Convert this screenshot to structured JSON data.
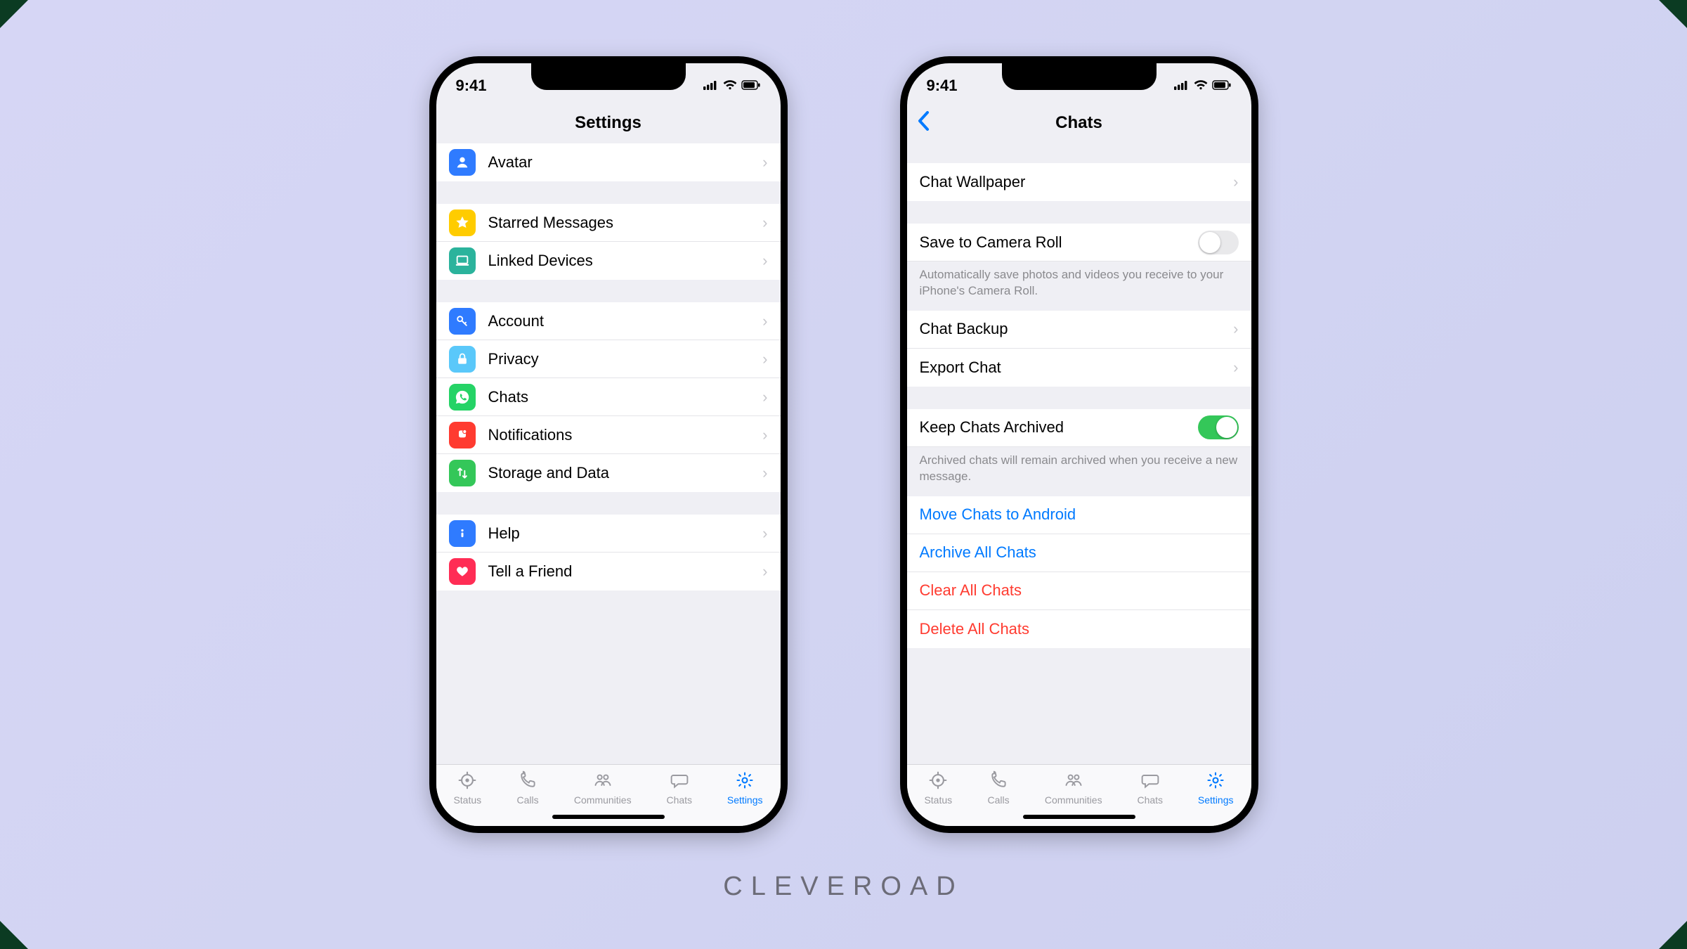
{
  "status": {
    "time": "9:41"
  },
  "brand": "CLEVEROAD",
  "tabs": [
    {
      "label": "Status"
    },
    {
      "label": "Calls"
    },
    {
      "label": "Communities"
    },
    {
      "label": "Chats"
    },
    {
      "label": "Settings"
    }
  ],
  "left": {
    "title": "Settings",
    "groups": [
      [
        {
          "label": "Avatar",
          "iconColor": "#2f7bff",
          "iconName": "avatar-icon"
        }
      ],
      [
        {
          "label": "Starred Messages",
          "iconColor": "#ffcc00",
          "iconName": "star-icon"
        },
        {
          "label": "Linked Devices",
          "iconColor": "#2bb39c",
          "iconName": "laptop-icon"
        }
      ],
      [
        {
          "label": "Account",
          "iconColor": "#2f7bff",
          "iconName": "key-icon"
        },
        {
          "label": "Privacy",
          "iconColor": "#5ac8fa",
          "iconName": "lock-icon"
        },
        {
          "label": "Chats",
          "iconColor": "#25d366",
          "iconName": "whatsapp-icon"
        },
        {
          "label": "Notifications",
          "iconColor": "#ff3b30",
          "iconName": "bell-icon"
        },
        {
          "label": "Storage and Data",
          "iconColor": "#34c759",
          "iconName": "arrows-icon"
        }
      ],
      [
        {
          "label": "Help",
          "iconColor": "#2f7bff",
          "iconName": "info-icon"
        },
        {
          "label": "Tell a Friend",
          "iconColor": "#ff2d55",
          "iconName": "heart-icon"
        }
      ]
    ]
  },
  "right": {
    "title": "Chats",
    "rows": {
      "wallpaper": "Chat Wallpaper",
      "saveRoll": "Save to Camera Roll",
      "saveRollNote": "Automatically save photos and videos you receive to your iPhone's Camera Roll.",
      "backup": "Chat Backup",
      "export": "Export Chat",
      "keepArch": "Keep Chats Archived",
      "keepArchNote": "Archived chats will remain archived when you receive a new message.",
      "move": "Move Chats to Android",
      "archiveAll": "Archive All Chats",
      "clearAll": "Clear All Chats",
      "deleteAll": "Delete All Chats"
    },
    "saveRollOn": false,
    "keepArchOn": true
  }
}
